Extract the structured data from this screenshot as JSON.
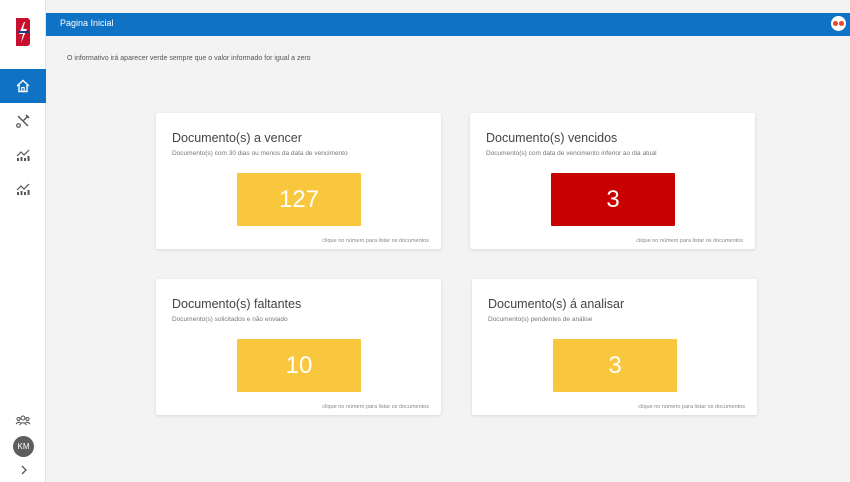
{
  "header": {
    "title": "Pagina Inicial"
  },
  "info_text": "O informativo irá aparecer verde sempre que o valor informado for igual a zero",
  "user": {
    "initials": "KM"
  },
  "sidebar": {
    "items": [
      {
        "name": "home-icon",
        "active": true
      },
      {
        "name": "tools-icon",
        "active": false
      },
      {
        "name": "chart-icon",
        "active": false
      },
      {
        "name": "chart-icon",
        "active": false
      }
    ]
  },
  "cards": [
    {
      "title": "Documento(s) a vencer",
      "subtitle": "Documento(s) com 30 dias ou menos da data de vencimento",
      "count": "127",
      "color": "#f9c73e",
      "hint": "clique no número para listar os documentos"
    },
    {
      "title": "Documento(s) vencidos",
      "subtitle": "Documento(s) com data de vencimento inferior ao dia atual",
      "count": "3",
      "color": "#c90000",
      "hint": "clique no número para listar os documentos"
    },
    {
      "title": "Documento(s) faltantes",
      "subtitle": "Documento(s) solicitados e não enviado",
      "count": "10",
      "color": "#f9c73e",
      "hint": "clique no número para listar os documentos"
    },
    {
      "title": "Documento(s) á analisar",
      "subtitle": "Documento(s) pendentes de análise",
      "count": "3",
      "color": "#f9c73e",
      "hint": "clique no número para listar os documentos"
    }
  ],
  "colors": {
    "accent": "#1072c4",
    "warning": "#f9c73e",
    "danger": "#c90000"
  }
}
